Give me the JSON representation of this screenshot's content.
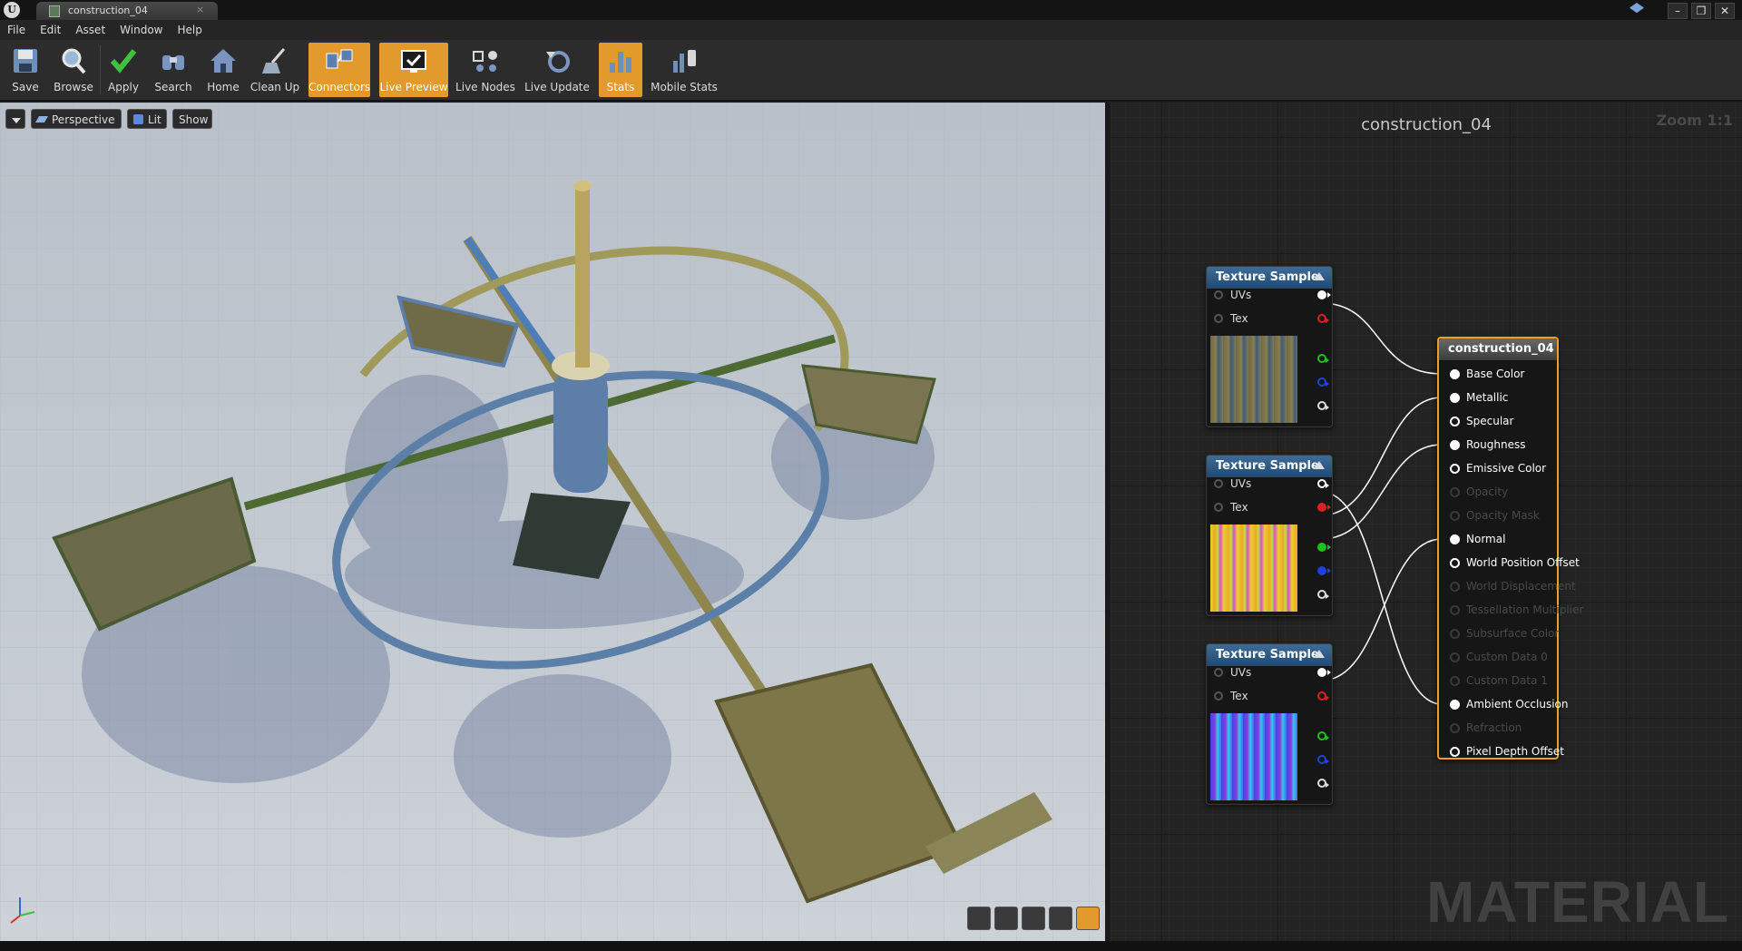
{
  "window": {
    "tab_title": "construction_04",
    "tab_close": "×",
    "controls": [
      "–",
      "❐",
      "✕"
    ]
  },
  "menu": [
    "File",
    "Edit",
    "Asset",
    "Window",
    "Help"
  ],
  "toolbar": [
    {
      "label": "Save",
      "icon": "save-icon",
      "active": false
    },
    {
      "label": "Browse",
      "icon": "magnifier-icon",
      "active": false
    },
    {
      "label": "Apply",
      "icon": "checkmark-icon",
      "active": false
    },
    {
      "label": "Search",
      "icon": "binoculars-icon",
      "active": false
    },
    {
      "label": "Home",
      "icon": "house-icon",
      "active": false
    },
    {
      "label": "Clean Up",
      "icon": "broom-icon",
      "active": false
    },
    {
      "label": "Connectors",
      "icon": "connectors-icon",
      "active": true
    },
    {
      "label": "Live Preview",
      "icon": "live-preview-icon",
      "active": true
    },
    {
      "label": "Live Nodes",
      "icon": "live-nodes-icon",
      "active": false
    },
    {
      "label": "Live Update",
      "icon": "live-update-icon",
      "active": false
    },
    {
      "label": "Stats",
      "icon": "stats-icon",
      "active": true
    },
    {
      "label": "Mobile Stats",
      "icon": "mobile-stats-icon",
      "active": false
    }
  ],
  "viewport": {
    "dropdown_icon": "chevron-down-icon",
    "perspective_label": "Perspective",
    "lit_label": "Lit",
    "show_label": "Show"
  },
  "graph": {
    "title": "construction_04",
    "zoom": "Zoom 1:1",
    "watermark": "MATERIAL",
    "texture_nodes": [
      {
        "title": "Texture Sample",
        "inputs": [
          "UVs",
          "Tex"
        ]
      },
      {
        "title": "Texture Sample",
        "inputs": [
          "UVs",
          "Tex"
        ]
      },
      {
        "title": "Texture Sample",
        "inputs": [
          "UVs",
          "Tex"
        ]
      }
    ],
    "output_pin_colors": [
      "#ffffff",
      "#e02020",
      "#20c020",
      "#2040e0",
      "#ffffff"
    ],
    "material_node": {
      "title": "construction_04",
      "inputs": [
        {
          "label": "Base Color",
          "state": "connected"
        },
        {
          "label": "Metallic",
          "state": "connected"
        },
        {
          "label": "Specular",
          "state": "open"
        },
        {
          "label": "Roughness",
          "state": "connected"
        },
        {
          "label": "Emissive Color",
          "state": "open"
        },
        {
          "label": "Opacity",
          "state": "disabled"
        },
        {
          "label": "Opacity Mask",
          "state": "disabled"
        },
        {
          "label": "Normal",
          "state": "connected"
        },
        {
          "label": "World Position Offset",
          "state": "open"
        },
        {
          "label": "World Displacement",
          "state": "disabled"
        },
        {
          "label": "Tessellation Multiplier",
          "state": "disabled"
        },
        {
          "label": "Subsurface Color",
          "state": "disabled"
        },
        {
          "label": "Custom Data 0",
          "state": "disabled"
        },
        {
          "label": "Custom Data 1",
          "state": "disabled"
        },
        {
          "label": "Ambient Occlusion",
          "state": "connected"
        },
        {
          "label": "Refraction",
          "state": "disabled"
        },
        {
          "label": "Pixel Depth Offset",
          "state": "open"
        }
      ]
    }
  }
}
